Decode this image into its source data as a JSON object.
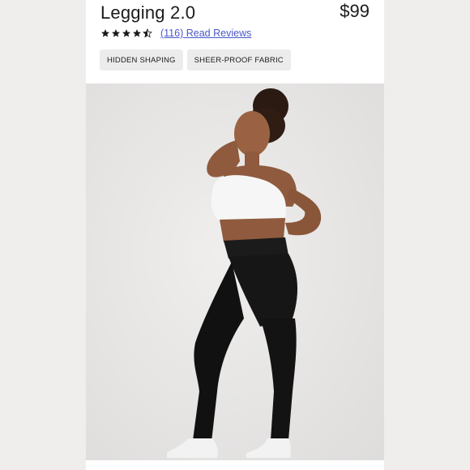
{
  "product": {
    "title": "Legging 2.0",
    "price": "$99",
    "rating": 4.5,
    "reviews_count": "(116)",
    "reviews_label": "Read Reviews"
  },
  "tags": [
    "HIDDEN SHAPING",
    "SHEER-PROOF FABRIC"
  ],
  "image": {
    "icon": "model-photo"
  },
  "colors": {
    "link": "#4a58c8",
    "tag_bg": "#ececec",
    "text": "#1b1b1b"
  }
}
